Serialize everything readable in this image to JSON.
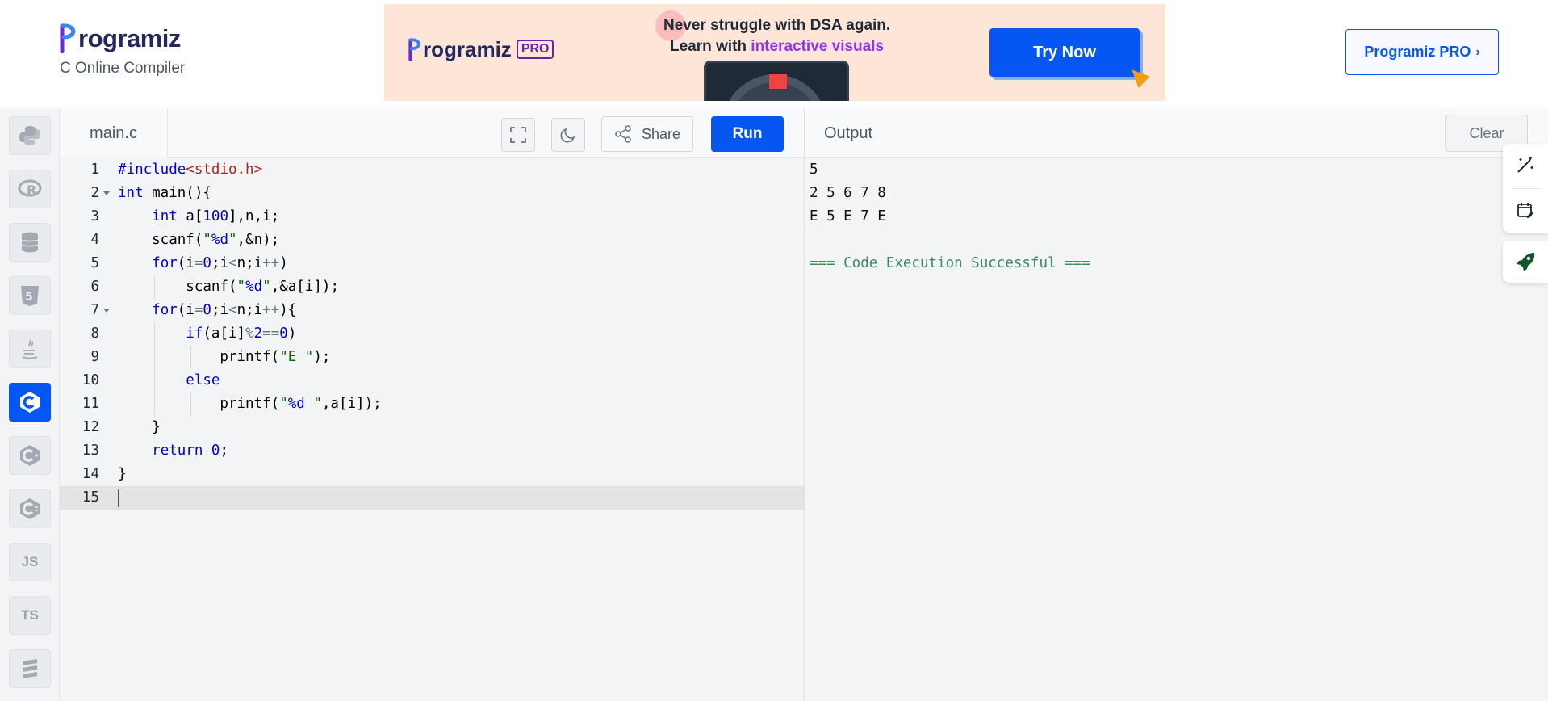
{
  "header": {
    "logo_text": "rogramiz",
    "subtitle": "C Online Compiler",
    "pro_button": "Programiz PRO",
    "pro_chevron": "›"
  },
  "ad": {
    "brand": "rogramiz",
    "badge": "PRO",
    "line1": "Never struggle with DSA again.",
    "line2_prefix": "Learn with ",
    "line2_highlight": "interactive visuals",
    "cta": "Try Now"
  },
  "sidebar": {
    "items": [
      {
        "name": "python",
        "icon": "python-icon",
        "label": ""
      },
      {
        "name": "r",
        "icon": "r-icon",
        "label": ""
      },
      {
        "name": "sql",
        "icon": "database-icon",
        "label": ""
      },
      {
        "name": "html",
        "icon": "html5-icon",
        "label": ""
      },
      {
        "name": "java",
        "icon": "java-icon",
        "label": ""
      },
      {
        "name": "c",
        "icon": "c-icon",
        "label": "",
        "active": true
      },
      {
        "name": "cpp",
        "icon": "cpp-icon",
        "label": ""
      },
      {
        "name": "csharp",
        "icon": "csharp-icon",
        "label": ""
      },
      {
        "name": "js",
        "icon": "js-icon",
        "label": "JS"
      },
      {
        "name": "ts",
        "icon": "ts-icon",
        "label": "TS"
      },
      {
        "name": "more",
        "icon": "stack-icon",
        "label": ""
      }
    ]
  },
  "editor": {
    "file_name": "main.c",
    "share_label": "Share",
    "run_label": "Run",
    "line_numbers": [
      "1",
      "2",
      "3",
      "4",
      "5",
      "6",
      "7",
      "8",
      "9",
      "10",
      "11",
      "12",
      "13",
      "14",
      "15"
    ],
    "current_line": 15
  },
  "output": {
    "title": "Output",
    "clear_label": "Clear",
    "lines": [
      "5",
      "2 5 6 7 8",
      "E 5 E 7 E",
      "",
      "=== Code Execution Successful ==="
    ]
  },
  "colors": {
    "accent": "#0556f3",
    "editor_bg": "#f3f4f6",
    "keyword": "#0000cc",
    "string": "#036a07",
    "include": "#b22222",
    "success": "#3a8a5a"
  }
}
